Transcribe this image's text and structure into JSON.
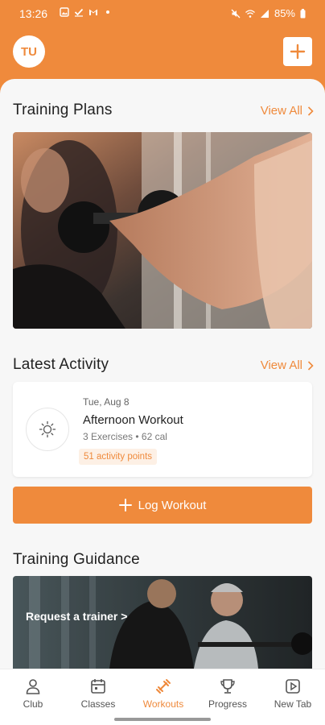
{
  "status_bar": {
    "time": "13:26",
    "battery": "85%"
  },
  "header": {
    "avatar_initials": "TU"
  },
  "training_plans": {
    "title": "Training Plans",
    "view_all": "View All"
  },
  "latest_activity": {
    "title": "Latest Activity",
    "view_all": "View All",
    "card": {
      "date": "Tue, Aug 8",
      "title": "Afternoon Workout",
      "meta": "3 Exercises • 62 cal",
      "points": "51 activity points"
    }
  },
  "log_workout": {
    "label": "Log Workout"
  },
  "training_guidance": {
    "title": "Training Guidance",
    "cta": "Request a trainer >"
  },
  "bottom_nav": {
    "items": [
      {
        "label": "Club",
        "icon": "person-icon"
      },
      {
        "label": "Classes",
        "icon": "calendar-icon"
      },
      {
        "label": "Workouts",
        "icon": "dumbbell-icon",
        "active": true
      },
      {
        "label": "Progress",
        "icon": "trophy-icon"
      },
      {
        "label": "New Tab",
        "icon": "play-icon"
      }
    ]
  },
  "colors": {
    "accent": "#ef8a3c",
    "background": "#f7f7f7"
  }
}
